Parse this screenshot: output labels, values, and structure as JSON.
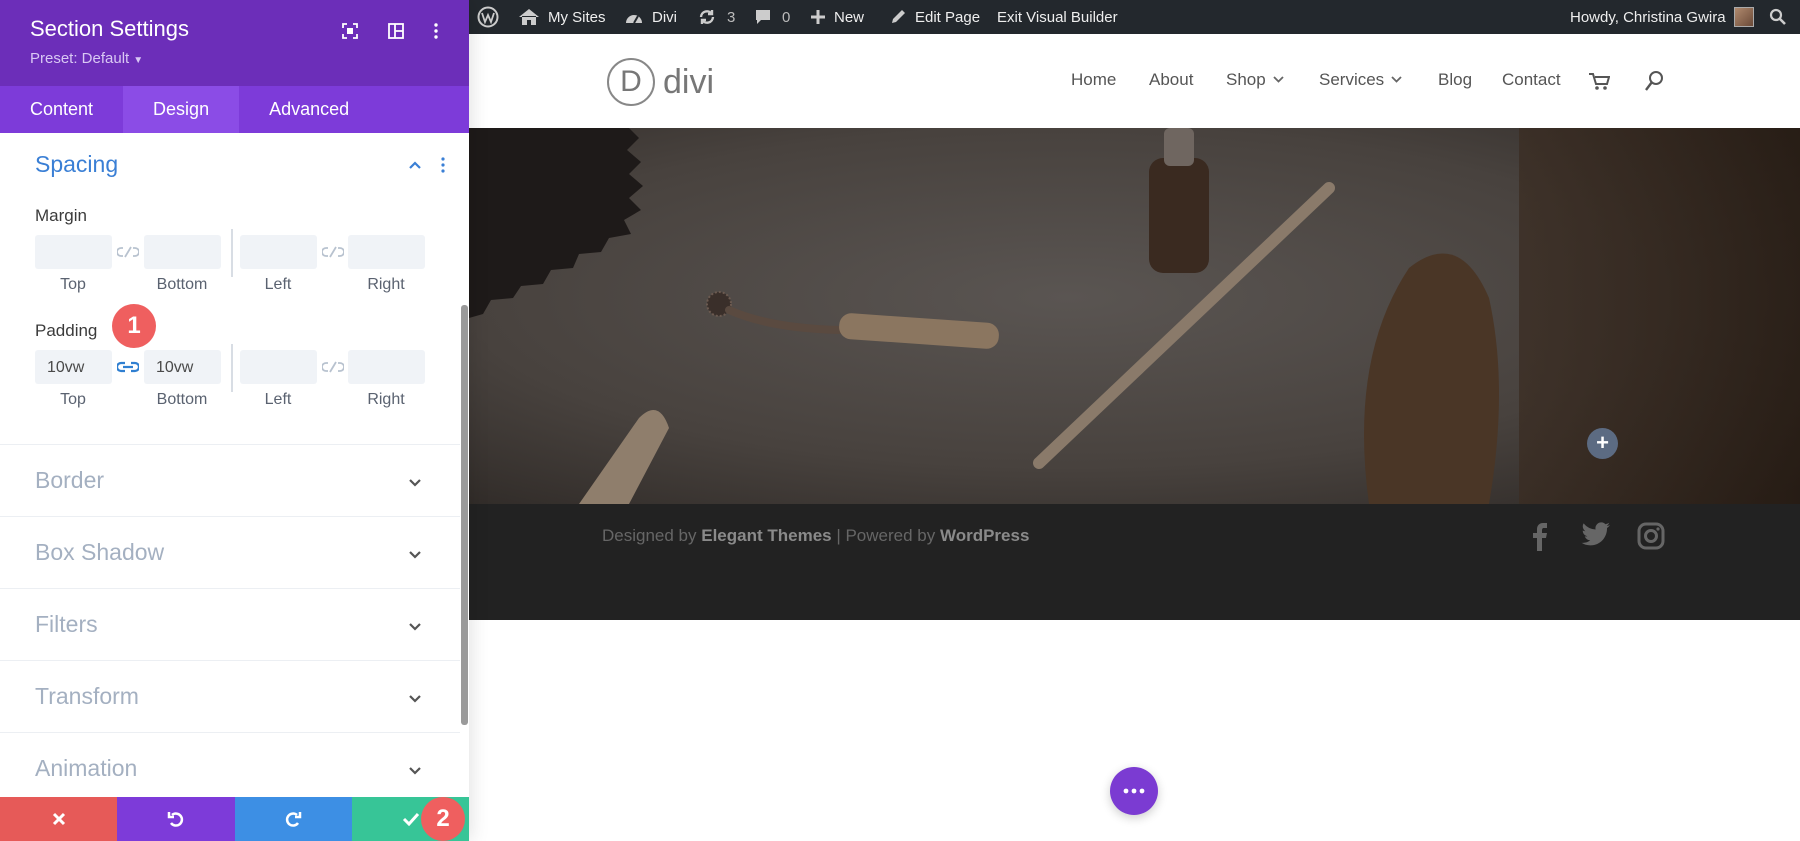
{
  "panel": {
    "title": "Section Settings",
    "preset": "Preset: Default",
    "tabs": [
      "Content",
      "Design",
      "Advanced"
    ],
    "active_tab": "Design",
    "spacing": {
      "title": "Spacing",
      "margin": {
        "label": "Margin",
        "top": "",
        "bottom": "",
        "left": "",
        "right": "",
        "sub_labels": [
          "Top",
          "Bottom",
          "Left",
          "Right"
        ]
      },
      "padding": {
        "label": "Padding",
        "top": "10vw",
        "bottom": "10vw",
        "left": "",
        "right": "",
        "sub_labels": [
          "Top",
          "Bottom",
          "Left",
          "Right"
        ]
      }
    },
    "groups": [
      "Border",
      "Box Shadow",
      "Filters",
      "Transform",
      "Animation"
    ],
    "badges": [
      "1",
      "2"
    ],
    "colors": {
      "header": "#6c2eb9",
      "tabs": "#7d3bd9",
      "cancel": "#e65a58",
      "undo": "#7d3bd9",
      "redo": "#3d8fe4",
      "save": "#37c597",
      "badge": "#ef5f5f",
      "accent": "#3a7fd5"
    }
  },
  "adminbar": {
    "items": [
      "My Sites",
      "Divi",
      "3",
      "0",
      "New",
      "Edit Page",
      "Exit Visual Builder"
    ],
    "greeting": "Howdy, Christina Gwira"
  },
  "site": {
    "logo_letter": "D",
    "logo_text": "divi",
    "nav": [
      "Home",
      "About",
      "Shop",
      "Services",
      "Blog",
      "Contact"
    ],
    "footer": {
      "prefix": "Designed by ",
      "brand": "Elegant Themes",
      "middle": " | Powered by ",
      "platform": "WordPress"
    },
    "add_module": "+"
  }
}
